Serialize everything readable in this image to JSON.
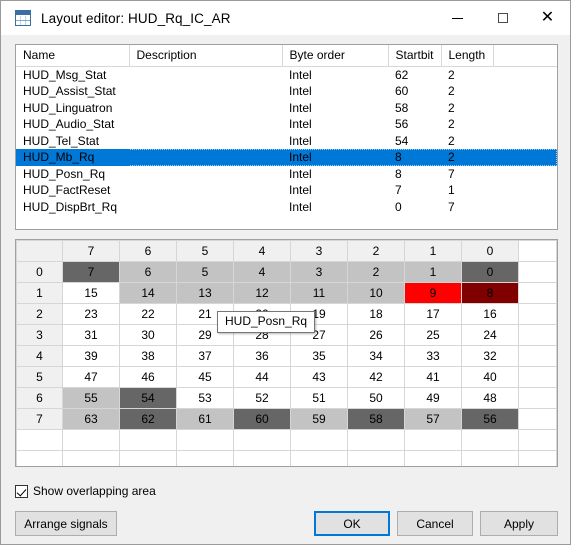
{
  "window": {
    "title": "Layout editor: HUD_Rq_IC_AR",
    "icon": "layout-grid-icon",
    "minimize_label": "—",
    "maximize_label": "□",
    "close_label": "✕"
  },
  "signal_list": {
    "columns": [
      "Name",
      "Description",
      "Byte order",
      "Startbit",
      "Length"
    ],
    "rows": [
      {
        "name": "HUD_Msg_Stat",
        "description": "",
        "byte_order": "Intel",
        "startbit": "62",
        "length": "2",
        "selected": false
      },
      {
        "name": "HUD_Assist_Stat",
        "description": "",
        "byte_order": "Intel",
        "startbit": "60",
        "length": "2",
        "selected": false
      },
      {
        "name": "HUD_Linguatron",
        "description": "",
        "byte_order": "Intel",
        "startbit": "58",
        "length": "2",
        "selected": false
      },
      {
        "name": "HUD_Audio_Stat",
        "description": "",
        "byte_order": "Intel",
        "startbit": "56",
        "length": "2",
        "selected": false
      },
      {
        "name": "HUD_Tel_Stat",
        "description": "",
        "byte_order": "Intel",
        "startbit": "54",
        "length": "2",
        "selected": false
      },
      {
        "name": "HUD_Mb_Rq",
        "description": "",
        "byte_order": "Intel",
        "startbit": "8",
        "length": "2",
        "selected": true
      },
      {
        "name": "HUD_Posn_Rq",
        "description": "",
        "byte_order": "Intel",
        "startbit": "8",
        "length": "7",
        "selected": false
      },
      {
        "name": "HUD_FactReset",
        "description": "",
        "byte_order": "Intel",
        "startbit": "7",
        "length": "1",
        "selected": false
      },
      {
        "name": "HUD_DispBrt_Rq",
        "description": "",
        "byte_order": "Intel",
        "startbit": "0",
        "length": "7",
        "selected": false
      }
    ]
  },
  "bit_matrix": {
    "corner_label": "",
    "column_headers": [
      "7",
      "6",
      "5",
      "4",
      "3",
      "2",
      "1",
      "0"
    ],
    "row_headers": [
      "0",
      "1",
      "2",
      "3",
      "4",
      "5",
      "6",
      "7"
    ],
    "rows": [
      {
        "header": "0",
        "cells": [
          {
            "value": "7",
            "state": "dark"
          },
          {
            "value": "6",
            "state": "light"
          },
          {
            "value": "5",
            "state": "light"
          },
          {
            "value": "4",
            "state": "light"
          },
          {
            "value": "3",
            "state": "light"
          },
          {
            "value": "2",
            "state": "light"
          },
          {
            "value": "1",
            "state": "light"
          },
          {
            "value": "0",
            "state": "dark"
          }
        ]
      },
      {
        "header": "1",
        "cells": [
          {
            "value": "15",
            "state": "white"
          },
          {
            "value": "14",
            "state": "light"
          },
          {
            "value": "13",
            "state": "light"
          },
          {
            "value": "12",
            "state": "light"
          },
          {
            "value": "11",
            "state": "light"
          },
          {
            "value": "10",
            "state": "light"
          },
          {
            "value": "9",
            "state": "red"
          },
          {
            "value": "8",
            "state": "darkred"
          }
        ]
      },
      {
        "header": "2",
        "cells": [
          {
            "value": "23",
            "state": "white"
          },
          {
            "value": "22",
            "state": "white"
          },
          {
            "value": "21",
            "state": "white"
          },
          {
            "value": "20",
            "state": "white"
          },
          {
            "value": "19",
            "state": "white"
          },
          {
            "value": "18",
            "state": "white"
          },
          {
            "value": "17",
            "state": "white"
          },
          {
            "value": "16",
            "state": "white"
          }
        ]
      },
      {
        "header": "3",
        "cells": [
          {
            "value": "31",
            "state": "white"
          },
          {
            "value": "30",
            "state": "white"
          },
          {
            "value": "29",
            "state": "white"
          },
          {
            "value": "28",
            "state": "white"
          },
          {
            "value": "27",
            "state": "white"
          },
          {
            "value": "26",
            "state": "white"
          },
          {
            "value": "25",
            "state": "white"
          },
          {
            "value": "24",
            "state": "white"
          }
        ]
      },
      {
        "header": "4",
        "cells": [
          {
            "value": "39",
            "state": "white"
          },
          {
            "value": "38",
            "state": "white"
          },
          {
            "value": "37",
            "state": "white"
          },
          {
            "value": "36",
            "state": "white"
          },
          {
            "value": "35",
            "state": "white"
          },
          {
            "value": "34",
            "state": "white"
          },
          {
            "value": "33",
            "state": "white"
          },
          {
            "value": "32",
            "state": "white"
          }
        ]
      },
      {
        "header": "5",
        "cells": [
          {
            "value": "47",
            "state": "white"
          },
          {
            "value": "46",
            "state": "white"
          },
          {
            "value": "45",
            "state": "white"
          },
          {
            "value": "44",
            "state": "white"
          },
          {
            "value": "43",
            "state": "white"
          },
          {
            "value": "42",
            "state": "white"
          },
          {
            "value": "41",
            "state": "white"
          },
          {
            "value": "40",
            "state": "white"
          }
        ]
      },
      {
        "header": "6",
        "cells": [
          {
            "value": "55",
            "state": "light"
          },
          {
            "value": "54",
            "state": "dark"
          },
          {
            "value": "53",
            "state": "white"
          },
          {
            "value": "52",
            "state": "white"
          },
          {
            "value": "51",
            "state": "white"
          },
          {
            "value": "50",
            "state": "white"
          },
          {
            "value": "49",
            "state": "white"
          },
          {
            "value": "48",
            "state": "white"
          }
        ]
      },
      {
        "header": "7",
        "cells": [
          {
            "value": "63",
            "state": "light"
          },
          {
            "value": "62",
            "state": "dark"
          },
          {
            "value": "61",
            "state": "light"
          },
          {
            "value": "60",
            "state": "dark"
          },
          {
            "value": "59",
            "state": "light"
          },
          {
            "value": "58",
            "state": "dark"
          },
          {
            "value": "57",
            "state": "light"
          },
          {
            "value": "56",
            "state": "dark"
          }
        ]
      }
    ],
    "colors": {
      "white": "#ffffff",
      "light": "#c3c3c3",
      "dark": "#666666",
      "red": "#ff0000",
      "darkred": "#800000"
    }
  },
  "tooltip": {
    "text": "HUD_Posn_Rq"
  },
  "options": {
    "show_overlapping_area_label": "Show overlapping area",
    "show_overlapping_area_checked": true
  },
  "buttons": {
    "arrange_signals": "Arrange signals",
    "ok": "OK",
    "cancel": "Cancel",
    "apply": "Apply"
  },
  "theme": {
    "accent": "#0078d7",
    "window_bg": "#f0f0f0",
    "panel_bg": "#ffffff"
  }
}
